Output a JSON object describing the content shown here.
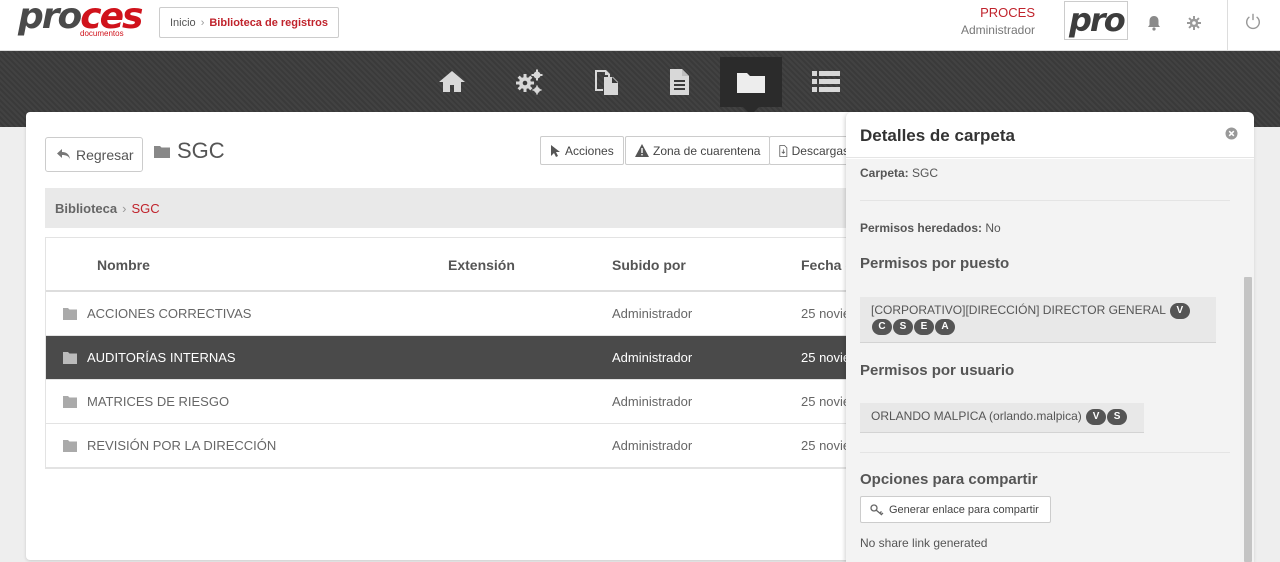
{
  "header": {
    "logo_text_dark": "pro",
    "logo_text_red": "ces",
    "logo_sub": "documentos",
    "breadcrumb": {
      "home": "Inicio",
      "current": "Biblioteca de registros"
    },
    "user_name": "PROCES",
    "user_role": "Administrador",
    "user_logo_text": "pro"
  },
  "nav": {
    "items": [
      {
        "icon": "home-icon"
      },
      {
        "icon": "gears-icon"
      },
      {
        "icon": "documents-icon"
      },
      {
        "icon": "document-icon"
      },
      {
        "icon": "folder-icon",
        "active": true
      },
      {
        "icon": "list-icon"
      }
    ]
  },
  "main": {
    "back_label": "Regresar",
    "folder_name": "SGC",
    "actions_label": "Acciones",
    "quarantine_label": "Zona de cuarentena",
    "download_label": "Descargas",
    "library_crumb": {
      "root": "Biblioteca",
      "current": "SGC"
    },
    "table": {
      "columns": [
        "Nombre",
        "Extensión",
        "Subido por",
        "Fecha c"
      ],
      "rows": [
        {
          "name": "ACCIONES CORRECTIVAS",
          "extension": "",
          "uploaded_by": "Administrador",
          "date": "25 novie"
        },
        {
          "name": "AUDITORÍAS INTERNAS",
          "extension": "",
          "uploaded_by": "Administrador",
          "date": "25 novie",
          "selected": true
        },
        {
          "name": "MATRICES DE RIESGO",
          "extension": "",
          "uploaded_by": "Administrador",
          "date": "25 novie"
        },
        {
          "name": "REVISIÓN POR LA DIRECCIÓN",
          "extension": "",
          "uploaded_by": "Administrador",
          "date": "25 novie"
        }
      ]
    }
  },
  "panel": {
    "title": "Detalles de carpeta",
    "folder_label": "Carpeta:",
    "folder_value": "SGC",
    "inherited_label": "Permisos heredados:",
    "inherited_value": "No",
    "by_position_heading": "Permisos por puesto",
    "position_entry": {
      "text": "[CORPORATIVO][DIRECCIÓN] DIRECTOR GENERAL",
      "badges": [
        "V",
        "C",
        "S",
        "E",
        "A"
      ]
    },
    "by_user_heading": "Permisos por usuario",
    "user_entry": {
      "text": "ORLANDO MALPICA (orlando.malpica)",
      "badges": [
        "V",
        "S"
      ]
    },
    "share_heading": "Opciones para compartir",
    "share_button": "Generar enlace para compartir",
    "share_status": "No share link generated"
  },
  "colors": {
    "brand_red": "#d0121b",
    "selected_row": "#4a4a4a",
    "nav_dark": "#3a3a3a"
  }
}
